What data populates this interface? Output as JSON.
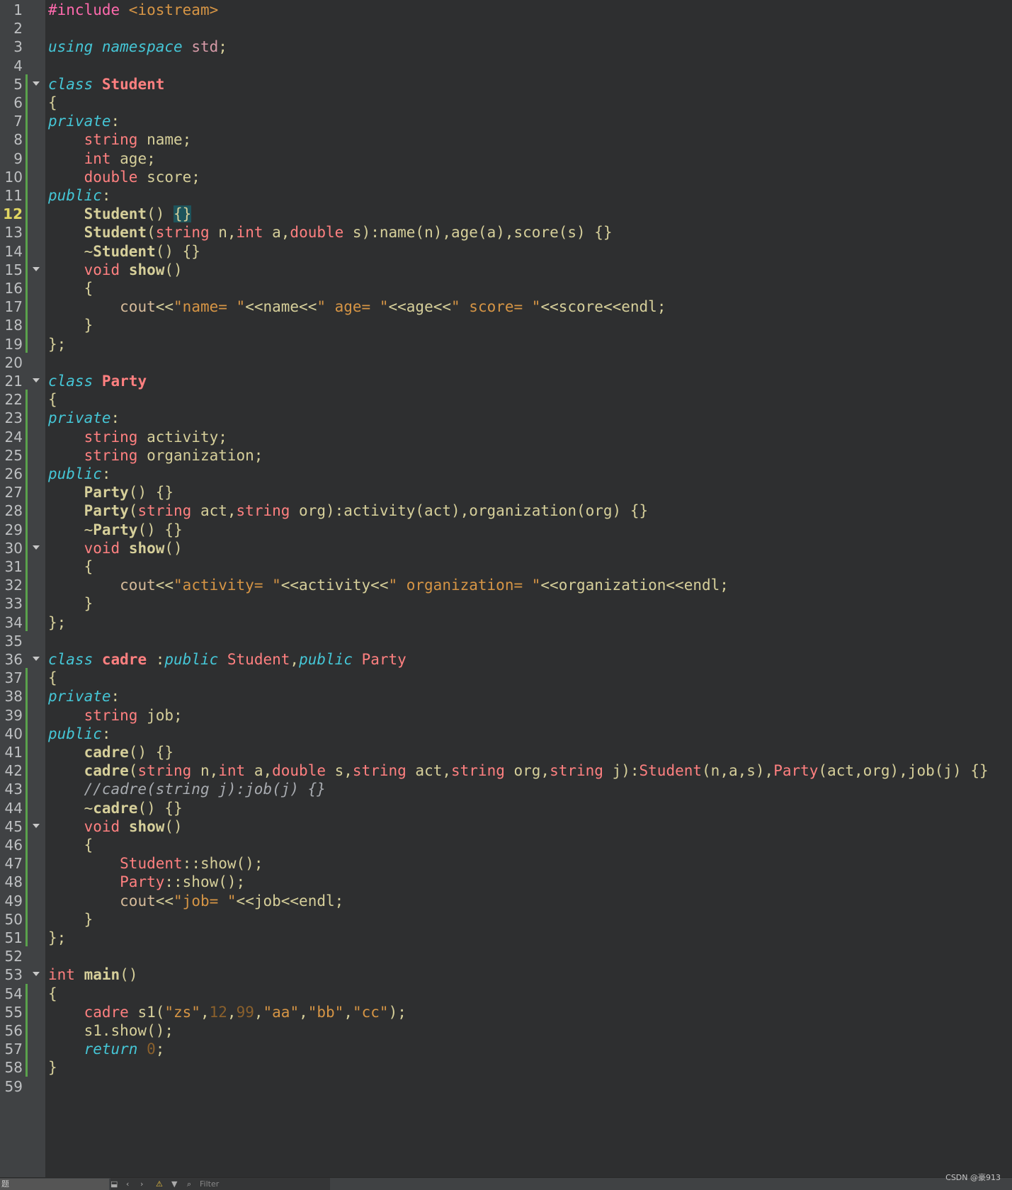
{
  "editor": {
    "current_line": 12,
    "lines": [
      {
        "n": "1",
        "segs": [
          [
            "pp",
            "#include "
          ],
          [
            "st",
            "<iostream>"
          ]
        ]
      },
      {
        "n": "2",
        "segs": []
      },
      {
        "n": "3",
        "segs": [
          [
            "kw",
            "using"
          ],
          [
            "",
            "&#32;"
          ],
          [
            "kw",
            "namespace"
          ],
          [
            "",
            ""
          ],
          [
            "tp",
            " std"
          ],
          [
            "",
            ";"
          ]
        ]
      },
      {
        "n": "4",
        "segs": []
      },
      {
        "n": "5",
        "fold": true,
        "segs": [
          [
            "kw",
            "class"
          ],
          [
            "",
            " "
          ],
          [
            "cls",
            "Student"
          ]
        ]
      },
      {
        "n": "6",
        "segs": [
          [
            "",
            "{"
          ]
        ]
      },
      {
        "n": "7",
        "segs": [
          [
            "kw",
            "private"
          ],
          [
            "",
            ":"
          ]
        ]
      },
      {
        "n": "8",
        "segs": [
          [
            "",
            "    "
          ],
          [
            "ty",
            "string"
          ],
          [
            "",
            " name;"
          ]
        ]
      },
      {
        "n": "9",
        "segs": [
          [
            "",
            "    "
          ],
          [
            "ty",
            "int"
          ],
          [
            "",
            " age;"
          ]
        ]
      },
      {
        "n": "10",
        "segs": [
          [
            "",
            "    "
          ],
          [
            "ty",
            "double"
          ],
          [
            "",
            " score;"
          ]
        ]
      },
      {
        "n": "11",
        "segs": [
          [
            "kw",
            "public"
          ],
          [
            "",
            ":"
          ]
        ]
      },
      {
        "n": "12",
        "segs": [
          [
            "",
            "    "
          ],
          [
            "fn",
            "Student"
          ],
          [
            "",
            "() "
          ],
          [
            "br",
            "{}"
          ]
        ]
      },
      {
        "n": "13",
        "segs": [
          [
            "",
            "    "
          ],
          [
            "fn",
            "Student"
          ],
          [
            "",
            "("
          ],
          [
            "ty",
            "string"
          ],
          [
            "",
            " n,"
          ],
          [
            "ty",
            "int"
          ],
          [
            "",
            " a,"
          ],
          [
            "ty",
            "double"
          ],
          [
            "",
            " s):name(n),age(a),score(s) {}"
          ]
        ]
      },
      {
        "n": "14",
        "segs": [
          [
            "",
            "    ~"
          ],
          [
            "fn",
            "Student"
          ],
          [
            "",
            "() {}"
          ]
        ]
      },
      {
        "n": "15",
        "fold": true,
        "segs": [
          [
            "",
            "    "
          ],
          [
            "ty",
            "void"
          ],
          [
            "",
            " "
          ],
          [
            "fn",
            "show"
          ],
          [
            "",
            "()"
          ]
        ]
      },
      {
        "n": "16",
        "segs": [
          [
            "",
            "    {"
          ]
        ]
      },
      {
        "n": "17",
        "segs": [
          [
            "",
            "        "
          ],
          [
            "mt",
            "cout"
          ],
          [
            "",
            "<<"
          ],
          [
            "st",
            "\"name= \""
          ],
          [
            "",
            "<<name<<"
          ],
          [
            "st",
            "\" age= \""
          ],
          [
            "",
            "<<age<<"
          ],
          [
            "st",
            "\" score= \""
          ],
          [
            "",
            "<<score<<endl;"
          ]
        ]
      },
      {
        "n": "18",
        "segs": [
          [
            "",
            "    }"
          ]
        ]
      },
      {
        "n": "19",
        "segs": [
          [
            "",
            "};"
          ]
        ]
      },
      {
        "n": "20",
        "segs": []
      },
      {
        "n": "21",
        "fold": true,
        "segs": [
          [
            "kw",
            "class"
          ],
          [
            "",
            " "
          ],
          [
            "cls",
            "Party"
          ]
        ]
      },
      {
        "n": "22",
        "segs": [
          [
            "",
            "{"
          ]
        ]
      },
      {
        "n": "23",
        "segs": [
          [
            "kw",
            "private"
          ],
          [
            "",
            ":"
          ]
        ]
      },
      {
        "n": "24",
        "segs": [
          [
            "",
            "    "
          ],
          [
            "ty",
            "string"
          ],
          [
            "",
            " activity;"
          ]
        ]
      },
      {
        "n": "25",
        "segs": [
          [
            "",
            "    "
          ],
          [
            "ty",
            "string"
          ],
          [
            "",
            " organization;"
          ]
        ]
      },
      {
        "n": "26",
        "segs": [
          [
            "kw",
            "public"
          ],
          [
            "",
            ":"
          ]
        ]
      },
      {
        "n": "27",
        "segs": [
          [
            "",
            "    "
          ],
          [
            "fn",
            "Party"
          ],
          [
            "",
            "() {}"
          ]
        ]
      },
      {
        "n": "28",
        "segs": [
          [
            "",
            "    "
          ],
          [
            "fn",
            "Party"
          ],
          [
            "",
            "("
          ],
          [
            "ty",
            "string"
          ],
          [
            "",
            " act,"
          ],
          [
            "ty",
            "string"
          ],
          [
            "",
            " org):activity(act),organization(org) {}"
          ]
        ]
      },
      {
        "n": "29",
        "segs": [
          [
            "",
            "    ~"
          ],
          [
            "fn",
            "Party"
          ],
          [
            "",
            "() {}"
          ]
        ]
      },
      {
        "n": "30",
        "fold": true,
        "segs": [
          [
            "",
            "    "
          ],
          [
            "ty",
            "void"
          ],
          [
            "",
            " "
          ],
          [
            "fn",
            "show"
          ],
          [
            "",
            "()"
          ]
        ]
      },
      {
        "n": "31",
        "segs": [
          [
            "",
            "    {"
          ]
        ]
      },
      {
        "n": "32",
        "segs": [
          [
            "",
            "        "
          ],
          [
            "mt",
            "cout"
          ],
          [
            "",
            "<<"
          ],
          [
            "st",
            "\"activity= \""
          ],
          [
            "",
            "<<activity<<"
          ],
          [
            "st",
            "\" organization= \""
          ],
          [
            "",
            "<<organization<<endl;"
          ]
        ]
      },
      {
        "n": "33",
        "segs": [
          [
            "",
            "    }"
          ]
        ]
      },
      {
        "n": "34",
        "segs": [
          [
            "",
            "};"
          ]
        ]
      },
      {
        "n": "35",
        "segs": []
      },
      {
        "n": "36",
        "fold": true,
        "segs": [
          [
            "kw",
            "class"
          ],
          [
            "",
            " "
          ],
          [
            "cls",
            "cadre"
          ],
          [
            "",
            " :"
          ],
          [
            "kw",
            "public"
          ],
          [
            "ty",
            " Student"
          ],
          [
            "",
            ","
          ],
          [
            "kw",
            "public"
          ],
          [
            "ty",
            " Party"
          ]
        ]
      },
      {
        "n": "37",
        "segs": [
          [
            "",
            "{"
          ]
        ]
      },
      {
        "n": "38",
        "segs": [
          [
            "kw",
            "private"
          ],
          [
            "",
            ":"
          ]
        ]
      },
      {
        "n": "39",
        "segs": [
          [
            "",
            "    "
          ],
          [
            "ty",
            "string"
          ],
          [
            "",
            " job;"
          ]
        ]
      },
      {
        "n": "40",
        "segs": [
          [
            "kw",
            "public"
          ],
          [
            "",
            ":"
          ]
        ]
      },
      {
        "n": "41",
        "segs": [
          [
            "",
            "    "
          ],
          [
            "fn",
            "cadre"
          ],
          [
            "",
            "() {}"
          ]
        ]
      },
      {
        "n": "42",
        "segs": [
          [
            "",
            "    "
          ],
          [
            "fn",
            "cadre"
          ],
          [
            "",
            "("
          ],
          [
            "ty",
            "string"
          ],
          [
            "",
            " n,"
          ],
          [
            "ty",
            "int"
          ],
          [
            "",
            " a,"
          ],
          [
            "ty",
            "double"
          ],
          [
            "",
            " s,"
          ],
          [
            "ty",
            "string"
          ],
          [
            "",
            " act,"
          ],
          [
            "ty",
            "string"
          ],
          [
            "",
            " org,"
          ],
          [
            "ty",
            "string"
          ],
          [
            "",
            " j):"
          ],
          [
            "ty",
            "Student"
          ],
          [
            "",
            "(n,a,s),"
          ],
          [
            "ty",
            "Party"
          ],
          [
            "",
            "(act,org),job(j) {}"
          ]
        ]
      },
      {
        "n": "43",
        "segs": [
          [
            "",
            "    "
          ],
          [
            "cm",
            "//cadre(string j):job(j) {}"
          ]
        ]
      },
      {
        "n": "44",
        "segs": [
          [
            "",
            "    ~"
          ],
          [
            "fn",
            "cadre"
          ],
          [
            "",
            "() {}"
          ]
        ]
      },
      {
        "n": "45",
        "fold": true,
        "segs": [
          [
            "",
            "    "
          ],
          [
            "ty",
            "void"
          ],
          [
            "",
            " "
          ],
          [
            "fn",
            "show"
          ],
          [
            "",
            "()"
          ]
        ]
      },
      {
        "n": "46",
        "segs": [
          [
            "",
            "    {"
          ]
        ]
      },
      {
        "n": "47",
        "segs": [
          [
            "",
            "        "
          ],
          [
            "ty",
            "Student"
          ],
          [
            "",
            "::show();"
          ]
        ]
      },
      {
        "n": "48",
        "segs": [
          [
            "",
            "        "
          ],
          [
            "ty",
            "Party"
          ],
          [
            "",
            "::show();"
          ]
        ]
      },
      {
        "n": "49",
        "segs": [
          [
            "",
            "        "
          ],
          [
            "mt",
            "cout"
          ],
          [
            "",
            "<<"
          ],
          [
            "st",
            "\"job= \""
          ],
          [
            "",
            "<<job<<endl;"
          ]
        ]
      },
      {
        "n": "50",
        "segs": [
          [
            "",
            "    }"
          ]
        ]
      },
      {
        "n": "51",
        "segs": [
          [
            "",
            "};"
          ]
        ]
      },
      {
        "n": "52",
        "segs": []
      },
      {
        "n": "53",
        "fold": true,
        "segs": [
          [
            "ty",
            "int"
          ],
          [
            "",
            " "
          ],
          [
            "fn",
            "main"
          ],
          [
            "",
            "()"
          ]
        ]
      },
      {
        "n": "54",
        "segs": [
          [
            "",
            "{"
          ]
        ]
      },
      {
        "n": "55",
        "segs": [
          [
            "",
            "    "
          ],
          [
            "ty",
            "cadre"
          ],
          [
            "",
            " s1("
          ],
          [
            "st",
            "\"zs\""
          ],
          [
            "",
            ","
          ],
          [
            "nm",
            "12"
          ],
          [
            "",
            ","
          ],
          [
            "nm",
            "99"
          ],
          [
            "",
            ","
          ],
          [
            "st",
            "\"aa\""
          ],
          [
            "",
            ","
          ],
          [
            "st",
            "\"bb\""
          ],
          [
            "",
            ","
          ],
          [
            "st",
            "\"cc\""
          ],
          [
            "",
            ");"
          ]
        ]
      },
      {
        "n": "56",
        "segs": [
          [
            "",
            "    s1.show();"
          ]
        ]
      },
      {
        "n": "57",
        "segs": [
          [
            "",
            "    "
          ],
          [
            "kw",
            "return"
          ],
          [
            "",
            " "
          ],
          [
            "nm",
            "0"
          ],
          [
            "",
            ";"
          ]
        ]
      },
      {
        "n": "58",
        "segs": [
          [
            "",
            "}"
          ]
        ]
      },
      {
        "n": "59",
        "segs": []
      }
    ]
  },
  "statusbar": {
    "left_label": "题",
    "filter_placeholder": "Filter"
  },
  "watermark": "CSDN @豪913",
  "colors": {
    "background": "#2e2f30",
    "gutter": "#404244",
    "keyword": "#45c6d6",
    "type": "#ff8080",
    "string": "#d69545",
    "current_line_number": "#e0d562",
    "modified_marker": "#5aa24c"
  }
}
